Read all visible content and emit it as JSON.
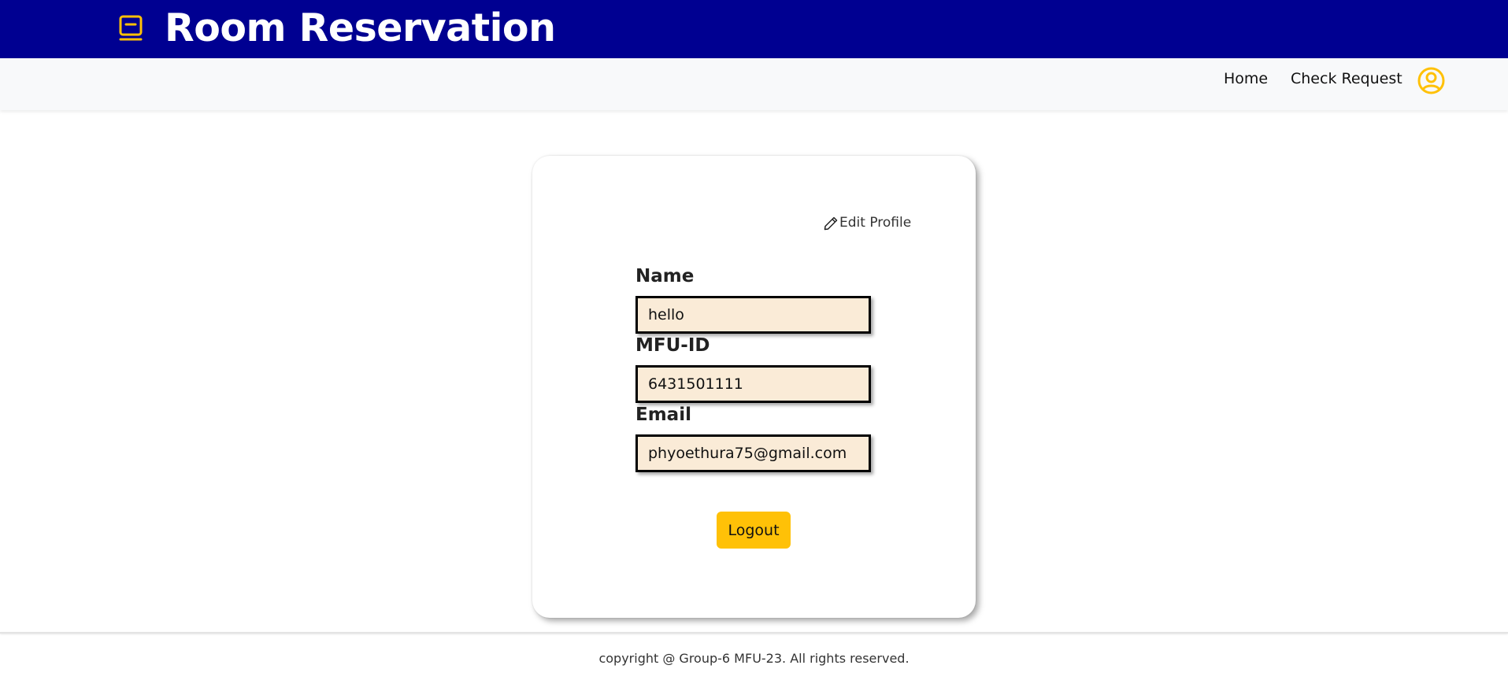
{
  "header": {
    "title": "Room Reservation",
    "icon": "book-icon",
    "background_color": "#000091",
    "accent_color": "#ffc107"
  },
  "nav": {
    "home_label": "Home",
    "check_request_label": "Check Request",
    "user_icon": "user-circle-icon"
  },
  "profile": {
    "edit_label": "Edit Profile",
    "edit_icon": "pencil-icon",
    "fields": [
      {
        "label": "Name",
        "value": "hello"
      },
      {
        "label": "MFU-ID",
        "value": "6431501111"
      },
      {
        "label": "Email",
        "value": "phyoethura75@gmail.com"
      }
    ],
    "input_background": "#faebd7",
    "logout_label": "Logout"
  },
  "footer": {
    "text": "copyright @ Group-6 MFU-23. All rights reserved."
  }
}
